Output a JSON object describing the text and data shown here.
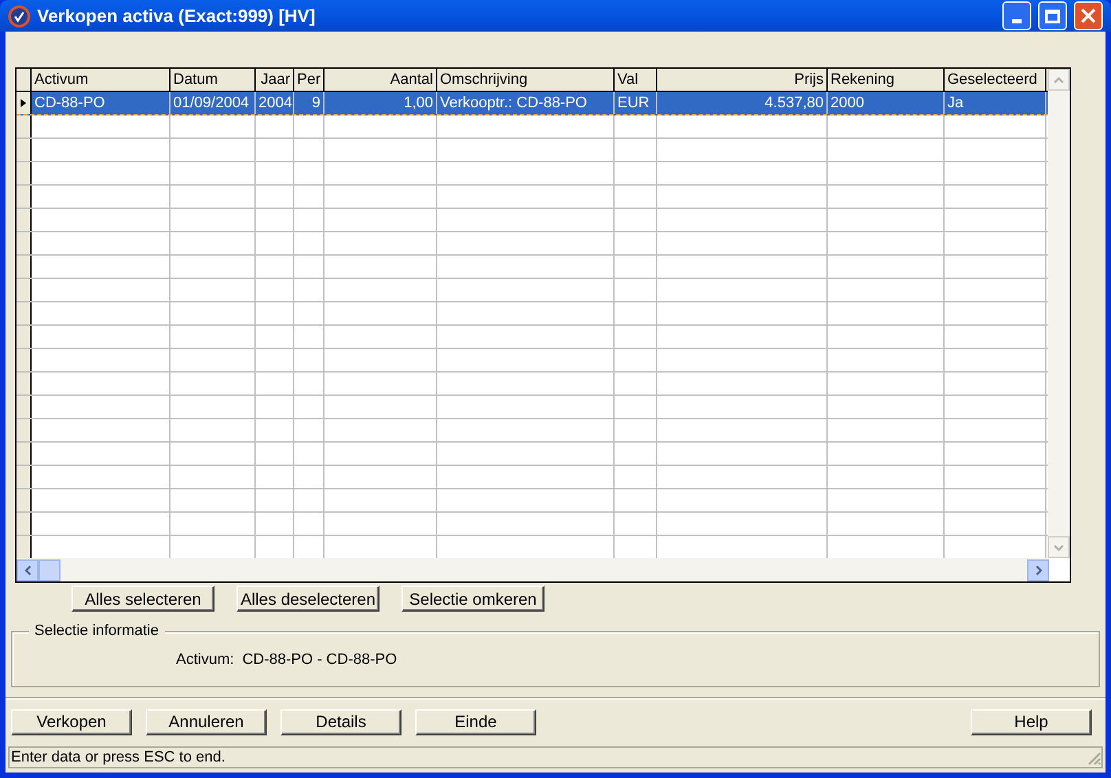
{
  "window": {
    "title": "Verkopen activa (Exact:999) [HV]"
  },
  "table": {
    "columns": [
      "Activum",
      "Datum",
      "Jaar",
      "Per",
      "Aantal",
      "Omschrijving",
      "Val",
      "Prijs",
      "Rekening",
      "Geselecteerd"
    ],
    "rows": [
      {
        "selected": true,
        "cells": [
          "CD-88-PO",
          "01/09/2004",
          "2004",
          "9",
          "1,00",
          "Verkooptr.: CD-88-PO",
          "EUR",
          "4.537,80",
          "2000",
          "Ja"
        ]
      }
    ]
  },
  "selection_buttons": [
    "Alles selecteren",
    "Alles deselecteren",
    "Selectie omkeren"
  ],
  "selection_info": {
    "title": "Selectie informatie",
    "label": "Activum:",
    "value": "CD-88-PO - CD-88-PO"
  },
  "action_buttons": [
    "Verkopen",
    "Annuleren",
    "Details",
    "Einde"
  ],
  "help_button": "Help",
  "status_bar": "Enter data or press ESC to end."
}
